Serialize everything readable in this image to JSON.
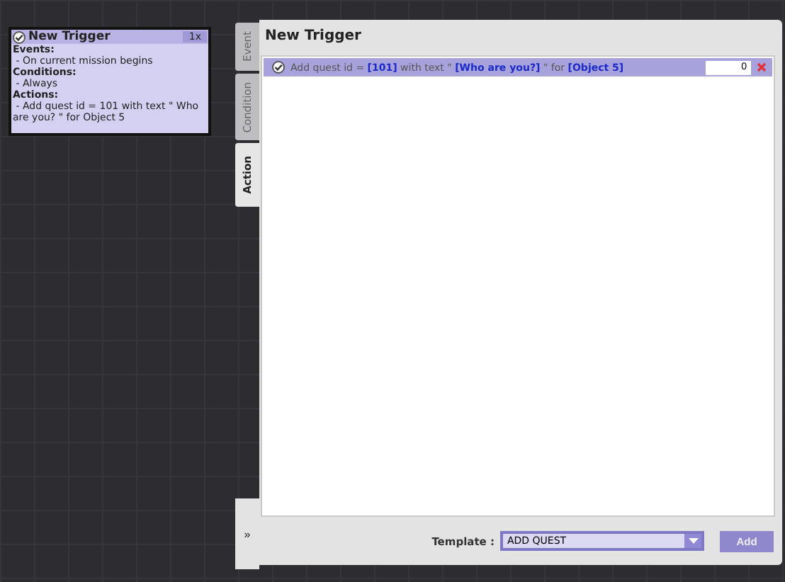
{
  "trigger_card": {
    "title": "New Trigger",
    "count": "1x",
    "checked": true,
    "lines": [
      {
        "kind": "heading",
        "text": "Events:"
      },
      {
        "kind": "item",
        "text": " - On current mission begins"
      },
      {
        "kind": "heading",
        "text": "Conditions:"
      },
      {
        "kind": "item",
        "text": " - Always"
      },
      {
        "kind": "heading",
        "text": "Actions:"
      },
      {
        "kind": "item",
        "text": " - Add quest id = 101 with text \" Who are you? \" for Object 5"
      }
    ]
  },
  "tabs": [
    {
      "label": "Event",
      "selected": false
    },
    {
      "label": "Condition",
      "selected": false
    },
    {
      "label": "Action",
      "selected": true
    }
  ],
  "expand_button": "»",
  "editor": {
    "title": "New Trigger",
    "actions": [
      {
        "text": "Add quest id = **[101]** with text \" **[Who are you?]** \" for **[Object 5]**",
        "value": "0",
        "checked": true
      }
    ],
    "template": {
      "label": "Template :",
      "value": "ADD QUEST"
    },
    "add_button": "Add"
  }
}
